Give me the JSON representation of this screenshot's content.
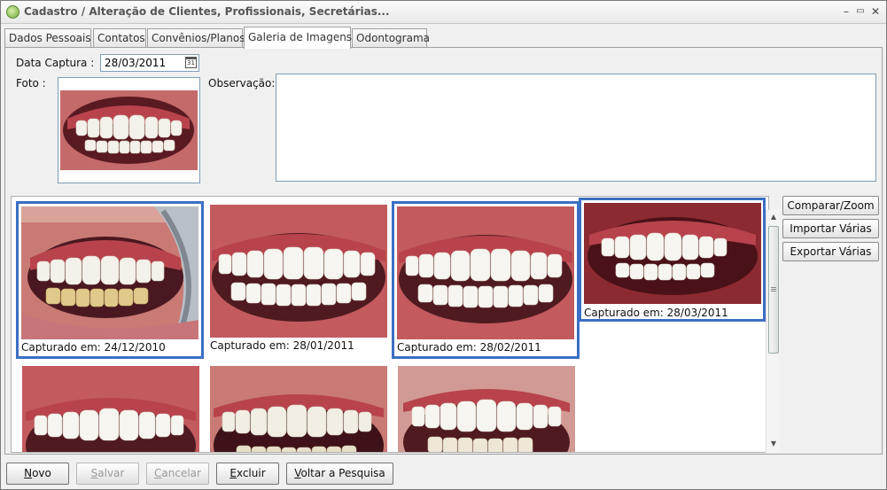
{
  "window": {
    "title": "Cadastro / Alteração de Clientes, Profissionais, Secretárias...",
    "controls": {
      "minimize": "–",
      "maximize": "▭",
      "close": "✕"
    }
  },
  "tabs": [
    {
      "label": "Dados Pessoais",
      "active": false
    },
    {
      "label": "Contatos",
      "active": false
    },
    {
      "label": "Convênios/Planos",
      "active": false
    },
    {
      "label": "Galeria de Imagens",
      "active": true
    },
    {
      "label": "Odontograma",
      "active": false
    }
  ],
  "form": {
    "date_label": "Data Captura :",
    "date_value": "28/03/2011",
    "calendar_icon_text": "31",
    "photo_label": "Foto :",
    "observation_label": "Observação:",
    "observation_value": ""
  },
  "gallery": {
    "items": [
      {
        "caption": "Capturado em:  24/12/2010",
        "selected": true
      },
      {
        "caption": "Capturado em:  28/01/2011",
        "selected": false
      },
      {
        "caption": "Capturado em:  28/02/2011",
        "selected": true
      },
      {
        "caption": "Capturado em:  28/03/2011",
        "selected": true
      },
      {
        "caption": "",
        "selected": false
      },
      {
        "caption": "",
        "selected": false
      },
      {
        "caption": "",
        "selected": false
      }
    ]
  },
  "side_buttons": {
    "compare": "Comparar/Zoom",
    "import": "Importar Várias",
    "export": "Exportar Várias"
  },
  "bottom_buttons": {
    "new": {
      "first": "N",
      "rest": "ovo"
    },
    "save": {
      "first": "S",
      "rest": "alvar"
    },
    "cancel": {
      "first": "C",
      "rest": "ancelar"
    },
    "delete": {
      "first": "E",
      "rest": "xcluir"
    },
    "back": {
      "first": "V",
      "rest": "oltar a Pesquisa"
    }
  },
  "colors": {
    "selection_border": "#3b6fc4",
    "gum": "#b8434d",
    "lip": "#c46a6a",
    "teeth": "#f4f1ea",
    "mouth_dark": "#5a1a22"
  }
}
